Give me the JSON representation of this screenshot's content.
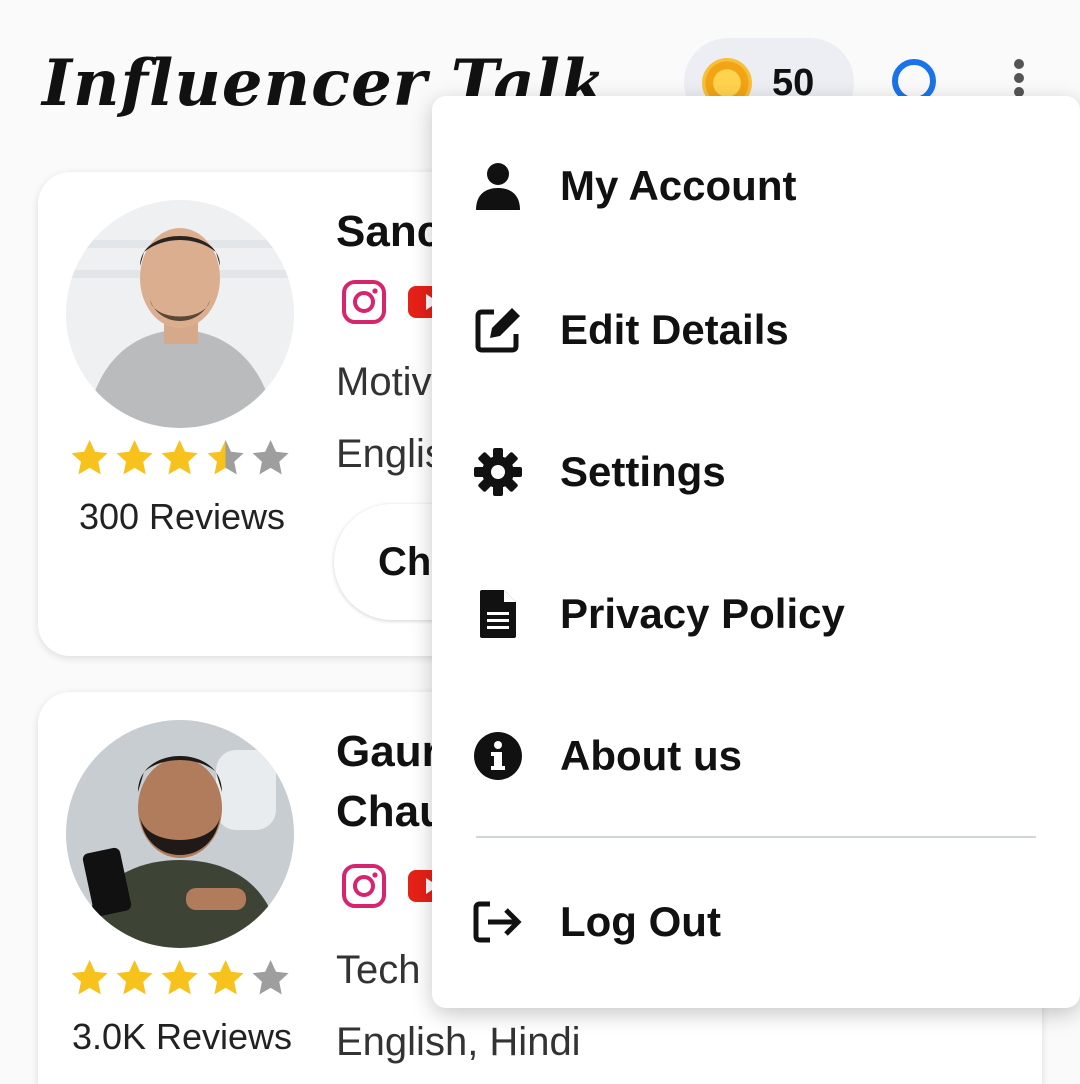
{
  "header": {
    "app_title": "Influencer Talk",
    "coin_count": "50",
    "icons": {
      "coin": "coin-icon",
      "search": "search-icon",
      "more": "more-vertical-icon"
    },
    "colors": {
      "accent": "#1a73e8",
      "coin": "#f2a414"
    }
  },
  "influencers": [
    {
      "name": "Sanc",
      "category": "Motiv",
      "languages": "Englis",
      "rating": 3.5,
      "rating_max": 5,
      "reviews": "300 Reviews",
      "chat_label": "Ch",
      "socials": [
        "instagram-icon",
        "youtube-icon"
      ]
    },
    {
      "name": "Gaur Chau",
      "category": "Tech",
      "languages": "English, Hindi",
      "rating": 4,
      "rating_max": 5,
      "reviews": "3.0K Reviews",
      "socials": [
        "instagram-icon",
        "youtube-icon"
      ]
    }
  ],
  "menu": {
    "items": [
      {
        "label": "My Account",
        "icon": "person-icon"
      },
      {
        "label": "Edit Details",
        "icon": "edit-icon"
      },
      {
        "label": "Settings",
        "icon": "gear-icon"
      },
      {
        "label": "Privacy Policy",
        "icon": "document-icon"
      },
      {
        "label": "About us",
        "icon": "info-icon"
      },
      {
        "label": "Log Out",
        "icon": "logout-icon"
      }
    ]
  },
  "colors": {
    "star_filled": "#f7c21b",
    "star_empty": "#9e9e9e",
    "instagram": "#d6246e",
    "youtube": "#e62117"
  }
}
